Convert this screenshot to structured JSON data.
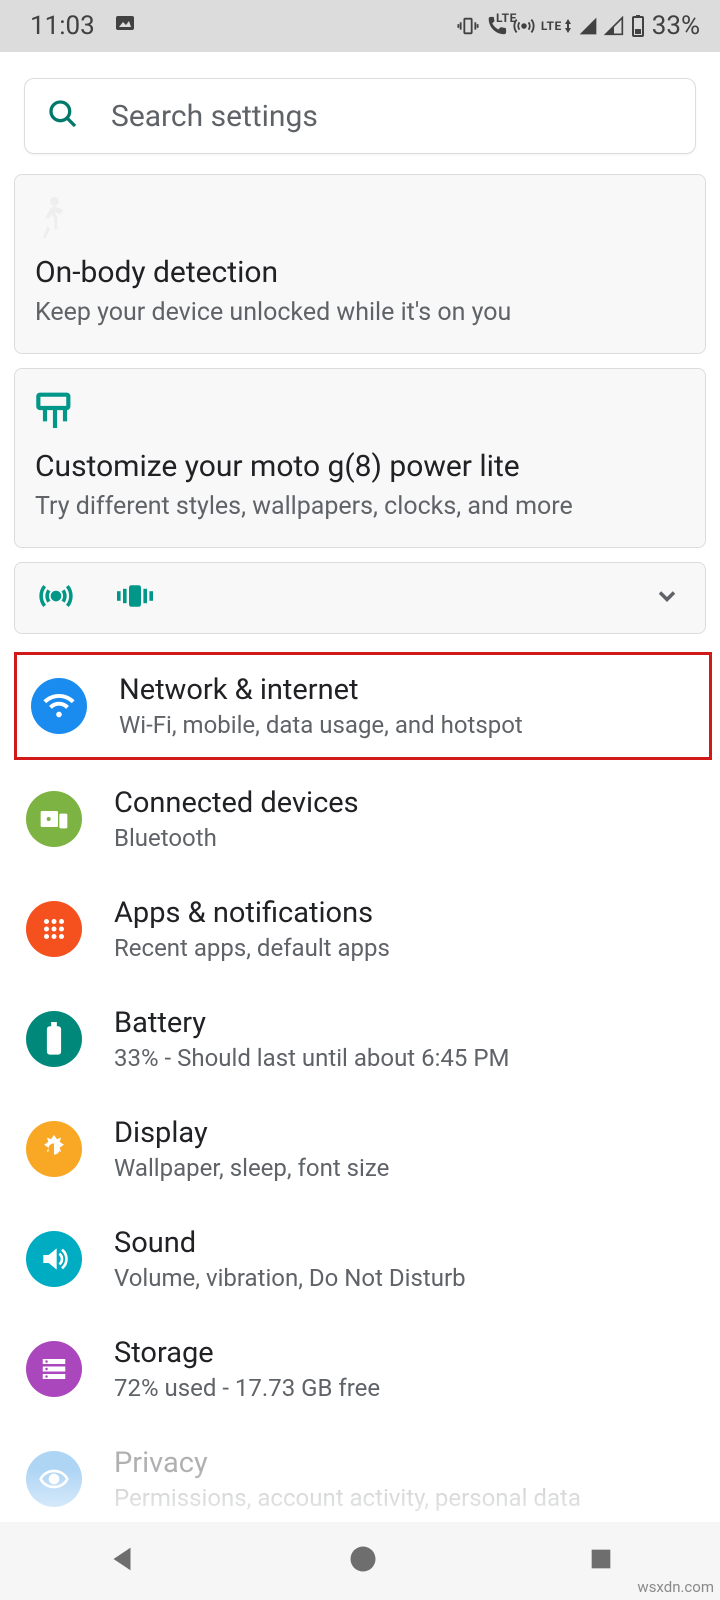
{
  "status": {
    "time": "11:03",
    "battery_pct": "33%",
    "lte_label": "LTE",
    "lte2_label": "LTE"
  },
  "search": {
    "placeholder": "Search settings"
  },
  "suggestions": [
    {
      "icon": "walk-icon",
      "title": "On-body detection",
      "subtitle": "Keep your device unlocked while it's on you"
    },
    {
      "icon": "paint-roller-icon",
      "title": "Customize your moto g(8) power lite",
      "subtitle": "Try different styles, wallpapers, clocks, and more"
    }
  ],
  "quick_toggles": {
    "items": [
      "hotspot-icon",
      "vibrate-icon"
    ]
  },
  "settings": [
    {
      "key": "network",
      "title": "Network & internet",
      "subtitle": "Wi-Fi, mobile, data usage, and hotspot",
      "color": "ic-blue",
      "icon": "wifi",
      "highlighted": true
    },
    {
      "key": "connected",
      "title": "Connected devices",
      "subtitle": "Bluetooth",
      "color": "ic-green",
      "icon": "devices"
    },
    {
      "key": "apps",
      "title": "Apps & notifications",
      "subtitle": "Recent apps, default apps",
      "color": "ic-orange",
      "icon": "apps"
    },
    {
      "key": "battery",
      "title": "Battery",
      "subtitle": "33% - Should last until about 6:45 PM",
      "color": "ic-teal",
      "icon": "battery"
    },
    {
      "key": "display",
      "title": "Display",
      "subtitle": "Wallpaper, sleep, font size",
      "color": "ic-amber",
      "icon": "brightness"
    },
    {
      "key": "sound",
      "title": "Sound",
      "subtitle": "Volume, vibration, Do Not Disturb",
      "color": "ic-cyan",
      "icon": "volume"
    },
    {
      "key": "storage",
      "title": "Storage",
      "subtitle": "72% used - 17.73 GB free",
      "color": "ic-purple",
      "icon": "storage"
    },
    {
      "key": "privacy",
      "title": "Privacy",
      "subtitle": "Permissions, account activity, personal data",
      "color": "ic-blue2",
      "icon": "privacy"
    }
  ],
  "watermark": "wsxdn.com"
}
